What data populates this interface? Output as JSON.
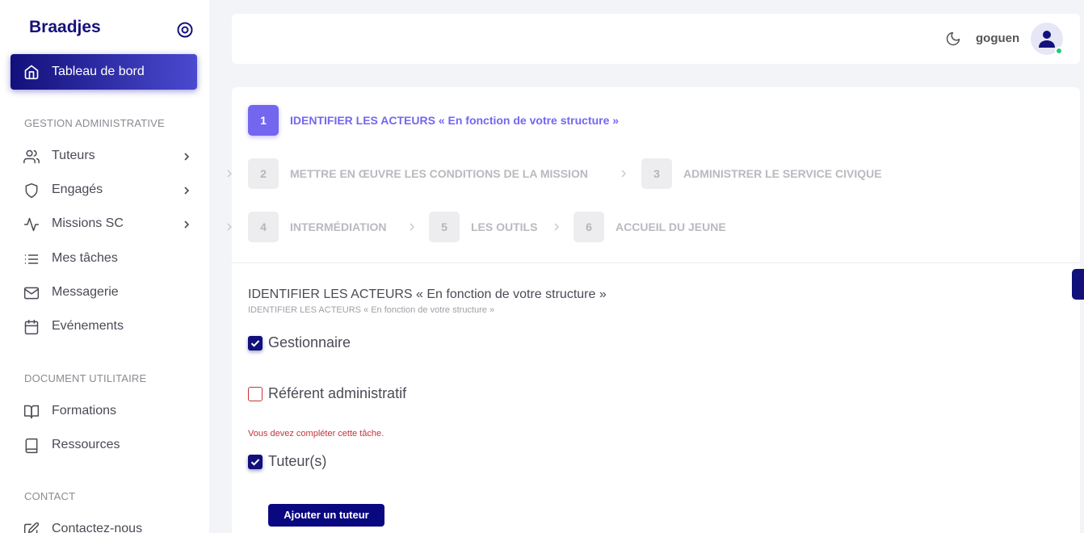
{
  "sidebar": {
    "brand": "Braadjes",
    "active_item": {
      "label": "Tableau de bord",
      "icon": "home-icon"
    },
    "sections": [
      {
        "title": "GESTION ADMINISTRATIVE"
      },
      {
        "title": "DOCUMENT UTILITAIRE"
      },
      {
        "title": "CONTACT"
      }
    ],
    "items": [
      {
        "label": "Tuteurs",
        "icon": "users-icon",
        "has_submenu": true
      },
      {
        "label": "Engagés",
        "icon": "shield-icon",
        "has_submenu": true
      },
      {
        "label": "Missions SC",
        "icon": "activity-icon",
        "has_submenu": true
      },
      {
        "label": "Mes tâches",
        "icon": "list-icon",
        "has_submenu": false
      },
      {
        "label": "Messagerie",
        "icon": "mail-icon",
        "has_submenu": false
      },
      {
        "label": "Evénements",
        "icon": "calendar-icon",
        "has_submenu": false
      },
      {
        "label": "Formations",
        "icon": "book-open-icon",
        "has_submenu": false
      },
      {
        "label": "Ressources",
        "icon": "book-icon",
        "has_submenu": false
      },
      {
        "label": "Contactez-nous",
        "icon": "edit-icon",
        "has_submenu": false
      }
    ]
  },
  "header": {
    "username": "goguen",
    "status": "online"
  },
  "wizard": {
    "steps": [
      {
        "number": "1",
        "label": "IDENTIFIER LES ACTEURS « En fonction de votre structure »",
        "active": true
      },
      {
        "number": "2",
        "label": "METTRE EN ŒUVRE LES CONDITIONS DE LA MISSION",
        "active": false
      },
      {
        "number": "3",
        "label": "ADMINISTRER LE SERVICE CIVIQUE",
        "active": false
      },
      {
        "number": "4",
        "label": "INTERMÉDIATION",
        "active": false
      },
      {
        "number": "5",
        "label": "LES OUTILS",
        "active": false
      },
      {
        "number": "6",
        "label": "ACCUEIL DU JEUNE",
        "active": false
      }
    ]
  },
  "content": {
    "title": "IDENTIFIER LES ACTEURS « En fonction de votre structure »",
    "subtitle": "IDENTIFIER LES ACTEURS « En fonction de votre structure »",
    "checkboxes": [
      {
        "label": "Gestionnaire",
        "checked": true
      },
      {
        "label": "Référent administratif",
        "checked": false
      },
      {
        "label": "Tuteur(s)",
        "checked": true
      }
    ],
    "error_message": "Vous devez compléter cette tâche.",
    "add_button": "Ajouter un tuteur"
  },
  "colors": {
    "primary": "#12107a",
    "active_step": "#7367f0",
    "error": "#c4343a",
    "online": "#28c76f"
  }
}
